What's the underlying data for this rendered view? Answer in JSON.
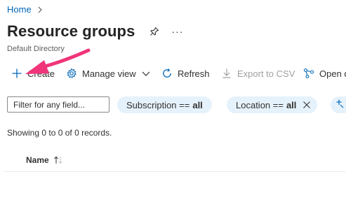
{
  "breadcrumb": {
    "home": "Home"
  },
  "header": {
    "title": "Resource groups",
    "subtitle": "Default Directory",
    "more": "···"
  },
  "toolbar": {
    "create": "Create",
    "manage_view": "Manage view",
    "refresh": "Refresh",
    "export_csv": "Export to CSV",
    "open_query": "Open query"
  },
  "filters": {
    "search_placeholder": "Filter for any field...",
    "subscription": {
      "label": "Subscription ==",
      "value": "all"
    },
    "location": {
      "label": "Location ==",
      "value": "all"
    }
  },
  "records_text": "Showing 0 to 0 of 0 records.",
  "table": {
    "columns": [
      "Name"
    ]
  },
  "colors": {
    "link": "#0067b8",
    "pill_bg": "#e6f2fb",
    "annotation_arrow": "#f0357a"
  },
  "icons": [
    "chevron-right-icon",
    "pin-icon",
    "more-icon",
    "plus-icon",
    "gear-icon",
    "chevron-down-icon",
    "refresh-icon",
    "download-icon",
    "query-icon",
    "close-icon",
    "add-filter-icon",
    "sort-icon"
  ]
}
